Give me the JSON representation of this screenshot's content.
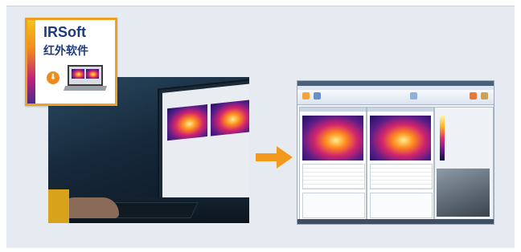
{
  "logo": {
    "title": "IRSoft",
    "subtitle": "红外软件",
    "download_icon": "download-icon"
  },
  "arrow": {
    "icon": "arrow-right-icon",
    "color": "#f39a1e"
  },
  "colors": {
    "panel_background": "#e6ebf1",
    "logo_border": "#f0a020",
    "logo_text": "#1c3b7a",
    "arrow": "#f39a1e"
  }
}
